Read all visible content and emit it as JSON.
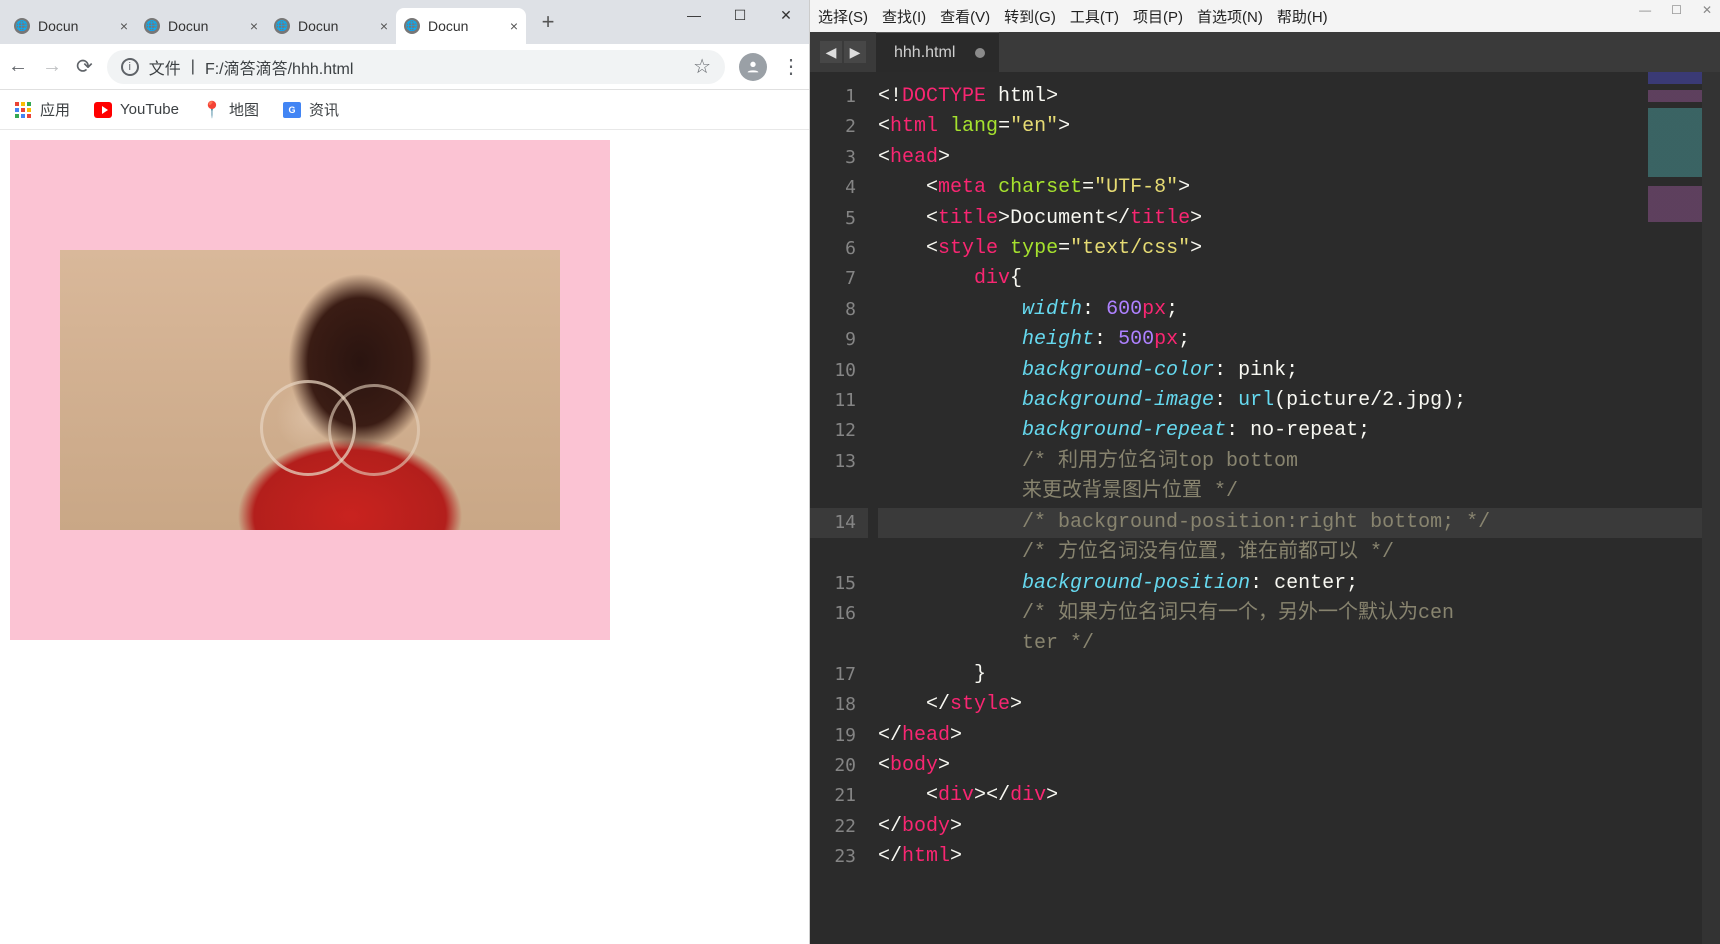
{
  "browser": {
    "tabs": [
      {
        "label": "Docun",
        "active": false
      },
      {
        "label": "Docun",
        "active": false
      },
      {
        "label": "Docun",
        "active": false
      },
      {
        "label": "Docun",
        "active": true
      }
    ],
    "address_prefix": "文件",
    "address_url": "F:/滴答滴答/hhh.html",
    "bookmarks": {
      "apps": "应用",
      "youtube": "YouTube",
      "maps": "地图",
      "news": "资讯"
    },
    "win": {
      "min": "—",
      "max": "☐",
      "close": "✕"
    }
  },
  "editor": {
    "menus": [
      "选择(S)",
      "查找(I)",
      "查看(V)",
      "转到(G)",
      "工具(T)",
      "项目(P)",
      "首选项(N)",
      "帮助(H)"
    ],
    "tab_name": "hhh.html",
    "line_numbers": [
      "1",
      "2",
      "3",
      "4",
      "5",
      "6",
      "7",
      "8",
      "9",
      "10",
      "11",
      "12",
      "13",
      "",
      "14",
      "",
      "15",
      "16",
      "",
      "17",
      "18",
      "19",
      "20",
      "21",
      "22",
      "23"
    ],
    "highlight_row_index": 14,
    "code": {
      "l1": "<!DOCTYPE html>",
      "l2": "<html lang=\"en\">",
      "l3": "<head>",
      "l4": "<meta charset=\"UTF-8\">",
      "l5": "<title>Document</title>",
      "l6": "<style type=\"text/css\">",
      "l7_sel": "div",
      "l8": {
        "prop": "width",
        "num": "600",
        "unit": "px"
      },
      "l9": {
        "prop": "height",
        "num": "500",
        "unit": "px"
      },
      "l10": {
        "prop": "background-color",
        "val": "pink"
      },
      "l11": {
        "prop": "background-image",
        "func": "url",
        "arg": "picture/2.jpg"
      },
      "l12": {
        "prop": "background-repeat",
        "val": "no-repeat"
      },
      "c13a": "/* 利用方位名词top bottom",
      "c13b": "来更改背景图片位置 */",
      "c14a": "/* background-position:right bottom; */",
      "c14b": "/* 方位名词没有位置，谁在前都可以 */",
      "l15": {
        "prop": "background-position",
        "val": "center"
      },
      "c16a": "/* 如果方位名词只有一个，另外一个默认为cen",
      "c16b": "ter */",
      "l18": "</style>",
      "l19": "</head>",
      "l20": "<body>",
      "l21": "<div></div>",
      "l22": "</body>",
      "l23": "</html>"
    }
  }
}
